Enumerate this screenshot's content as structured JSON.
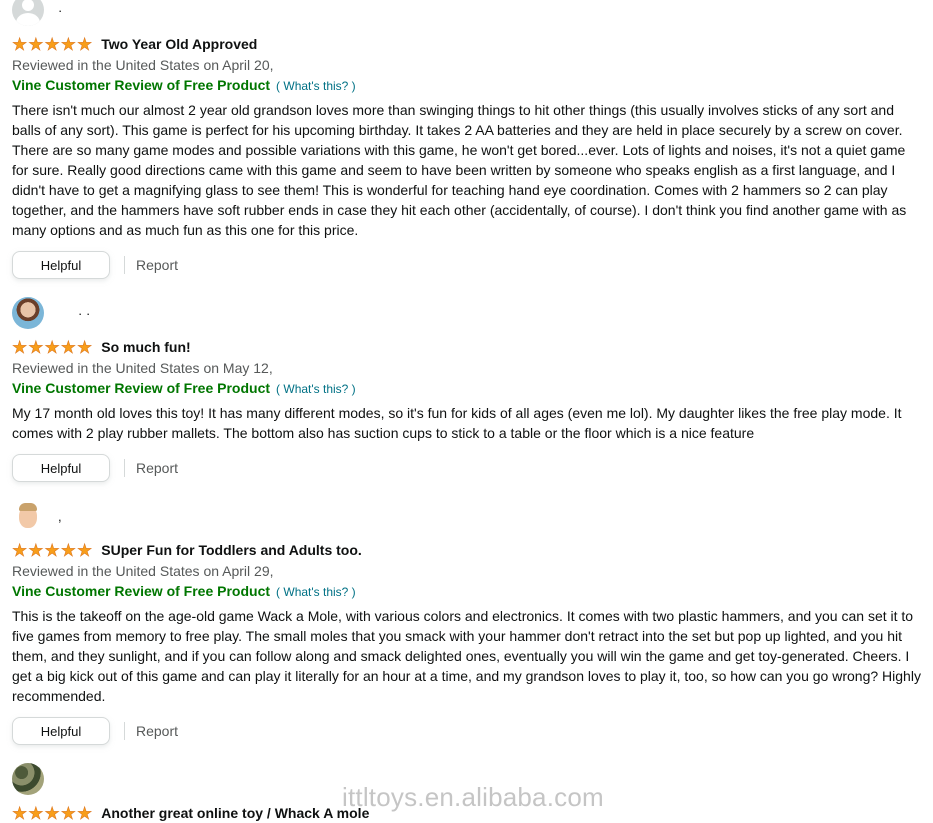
{
  "reviews": [
    {
      "avatar": "generic-user-icon",
      "name": "·",
      "rating": 5,
      "title": "Two Year Old Approved",
      "meta": "Reviewed in the United States on April 20,",
      "vine_label": "Vine Customer Review of Free Product",
      "whats_this": "( What's this? )",
      "body": "There isn't much our almost 2 year old grandson loves more than swinging things to hit other things (this usually involves sticks of any sort and balls of any sort). This game is perfect for his upcoming birthday. It takes 2 AA batteries and they are held in place securely by a screw on cover. There are so many game modes and possible variations with this game, he won't get bored...ever. Lots of lights and noises, it's not a quiet game for sure. Really good directions came with this game and seem to have been written by someone who speaks english as a first language, and I didn't have to get a magnifying glass to see them! This is wonderful for teaching hand eye coordination. Comes with 2 hammers so 2 can play together, and the hammers have soft rubber ends in case they hit each other (accidentally, of course). I don't think you find another game with as many options and as much fun as this one for this price.",
      "helpful_label": "Helpful",
      "report_label": "Report"
    },
    {
      "avatar": "photo-avatar",
      "name": "·  ·",
      "rating": 5,
      "title": "So much fun!",
      "meta": "Reviewed in the United States on May 12,",
      "vine_label": "Vine Customer Review of Free Product",
      "whats_this": "( What's this? )",
      "body": "My 17 month old loves this toy! It has many different modes, so it's fun for kids of all ages (even me lol). My daughter likes the free play mode. It comes with 2 play rubber mallets. The bottom also has suction cups to stick to a table or the floor which is a nice feature",
      "helpful_label": "Helpful",
      "report_label": "Report"
    },
    {
      "avatar": "cartoon-avatar",
      "name": ",",
      "rating": 5,
      "title": "SUper Fun for Toddlers and Adults too.",
      "meta": "Reviewed in the United States on April 29,",
      "vine_label": "Vine Customer Review of Free Product",
      "whats_this": "( What's this? )",
      "body": "This is the takeoff on the age-old game Wack a Mole, with various colors and electronics. It comes with two plastic hammers, and you can set it to five games from memory to free play. The small moles that you smack with your hammer don't retract into the set but pop up lighted, and you hit them, and they sunlight, and if you can follow along and smack delighted ones, eventually you will win the game and get toy-generated. Cheers. I get a big kick out of this game and can play it literally for an hour at a time, and my grandson loves to play it, too, so how can you go wrong? Highly recommended.",
      "helpful_label": "Helpful",
      "report_label": "Report"
    },
    {
      "avatar": "camo-avatar",
      "name": "",
      "rating": 5,
      "title": "Another great online toy / Whack A mole"
    }
  ],
  "watermark": "ittltoys.en.alibaba.com",
  "colors": {
    "star": "#f89e1a",
    "vine": "#007600",
    "link": "#007185",
    "meta": "#565959"
  }
}
